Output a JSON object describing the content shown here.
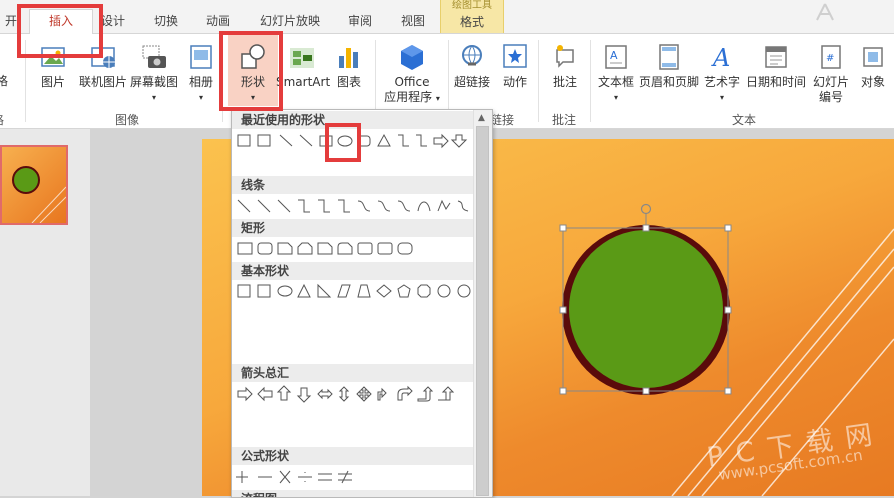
{
  "tabs": [
    "开始",
    "插入",
    "设计",
    "切换",
    "动画",
    "幻灯片放映",
    "审阅",
    "视图",
    "格式"
  ],
  "context_tab_label": "绘图工具",
  "ribbon": {
    "left_cut_labels": [
      "格",
      "格"
    ],
    "images": {
      "picture": "图片",
      "online_picture": "联机图片",
      "screenshot": "屏幕截图",
      "album": "相册",
      "group": "图像"
    },
    "illustrations": {
      "shape": "形状",
      "smartart": "SmartArt",
      "chart": "图表"
    },
    "apps": {
      "office": "Office",
      "office2": "应用程序"
    },
    "links": {
      "hyperlink": "超链接",
      "action": "动作",
      "group": "链接"
    },
    "comments": {
      "comment": "批注",
      "group": "批注"
    },
    "text": {
      "textbox": "文本框",
      "header_footer": "页眉和页脚",
      "wordart": "艺术字",
      "datetime": "日期和时间",
      "slide_number": "幻灯片",
      "slide_number2": "编号",
      "object": "对象",
      "group": "文本"
    }
  },
  "shapes_panel": {
    "sections": [
      "最近使用的形状",
      "线条",
      "矩形",
      "基本形状",
      "箭头总汇",
      "公式形状",
      "流程图"
    ]
  },
  "watermark": {
    "line1": "P C 下 载 网",
    "line2": "www.pcsoft.com.cn"
  },
  "colors": {
    "accent": "#c0392b",
    "highlight": "#e43c3c",
    "circle_fill": "#5a9a16",
    "circle_border": "#5a0b0b",
    "slide_top": "#fbc24e",
    "slide_bottom": "#e77a22"
  }
}
